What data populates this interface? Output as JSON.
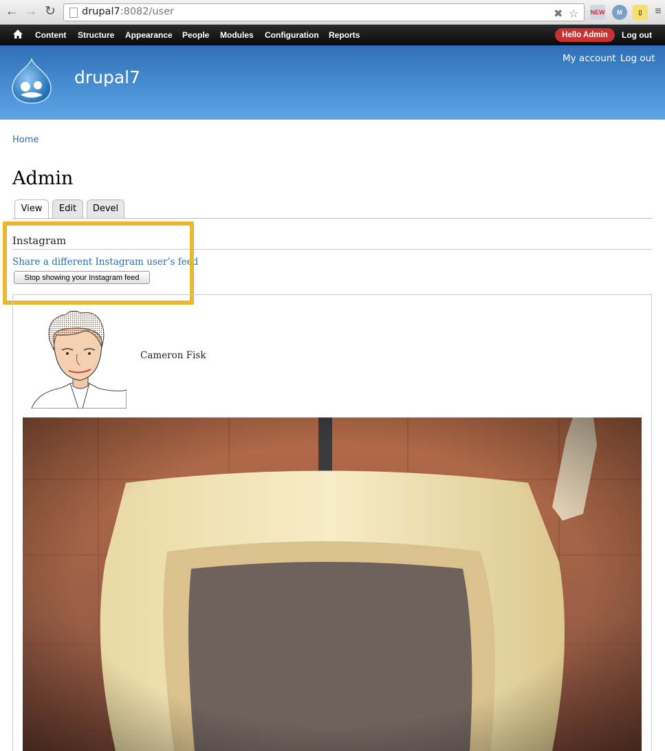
{
  "browser": {
    "url_host": "drupal7",
    "url_rest": ":8082/user"
  },
  "toolbar": {
    "items": [
      "Content",
      "Structure",
      "Appearance",
      "People",
      "Modules",
      "Configuration",
      "Reports"
    ],
    "hello_prefix": "Hello ",
    "hello_user": "Admin",
    "logout": "Log out"
  },
  "header": {
    "site_name": "drupal7",
    "my_account": "My account",
    "logout": "Log out"
  },
  "breadcrumb": "Home",
  "page_title": "Admin",
  "tabs": [
    "View",
    "Edit",
    "Devel"
  ],
  "active_tab": "View",
  "instagram": {
    "title": "Instagram",
    "share_link": "Share a different Instagram user’s feed",
    "stop_button": "Stop showing your Instagram feed"
  },
  "feed": {
    "user_name": "Cameron Fisk"
  },
  "colors": {
    "highlight": "#e8b92e",
    "link": "#2a6cb0",
    "header_top": "#2f6fb7",
    "header_bottom": "#5ea6e6",
    "hello_badge": "#c73333"
  }
}
